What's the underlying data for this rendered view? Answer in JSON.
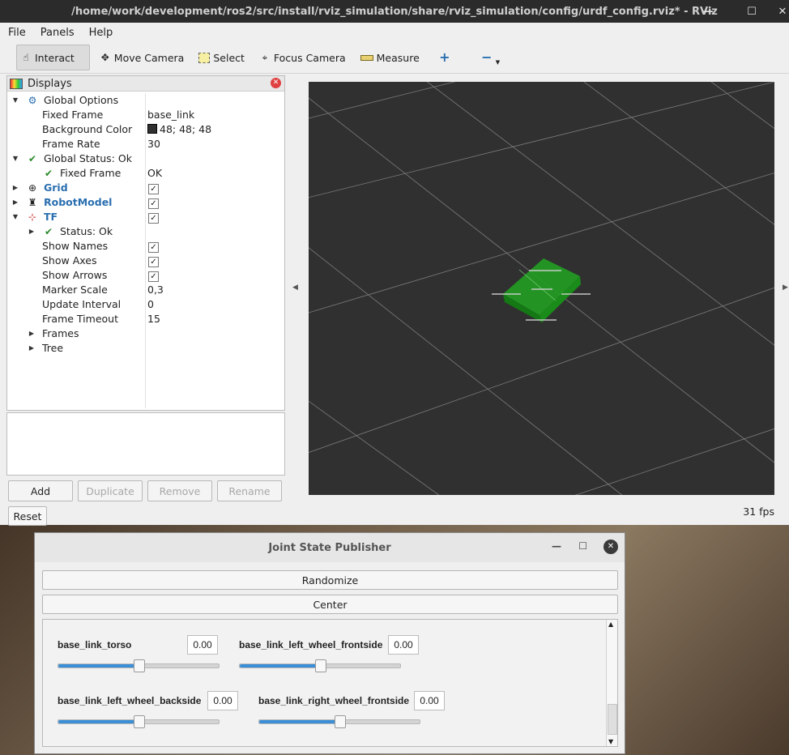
{
  "rviz": {
    "title": "/home/work/development/ros2/src/install/rviz_simulation/share/rviz_simulation/config/urdf_config.rviz* - RViz",
    "menu": [
      "File",
      "Panels",
      "Help"
    ],
    "toolbar": {
      "interact": "Interact",
      "move_camera": "Move Camera",
      "select": "Select",
      "focus_camera": "Focus Camera",
      "measure": "Measure"
    },
    "displays": {
      "title": "Displays",
      "global_options": "Global Options",
      "fixed_frame_label": "Fixed Frame",
      "fixed_frame_value": "base_link",
      "background_color_label": "Background Color",
      "background_color_value": "48; 48; 48",
      "frame_rate_label": "Frame Rate",
      "frame_rate_value": "30",
      "global_status": "Global Status: Ok",
      "status_fixed_frame_label": "Fixed Frame",
      "status_fixed_frame_value": "OK",
      "grid": "Grid",
      "robot_model": "RobotModel",
      "tf": "TF",
      "tf_status": "Status: Ok",
      "show_names": "Show Names",
      "show_axes": "Show Axes",
      "show_arrows": "Show Arrows",
      "marker_scale_label": "Marker Scale",
      "marker_scale_value": "0,3",
      "update_interval_label": "Update Interval",
      "update_interval_value": "0",
      "frame_timeout_label": "Frame Timeout",
      "frame_timeout_value": "15",
      "frames": "Frames",
      "tree": "Tree"
    },
    "buttons": {
      "add": "Add",
      "duplicate": "Duplicate",
      "remove": "Remove",
      "rename": "Rename",
      "reset": "Reset"
    },
    "fps": "31 fps",
    "colors": {
      "viewport_bg": "#303030",
      "robot": "#22a022",
      "accent": "#2a6fb0"
    }
  },
  "jsp": {
    "title": "Joint State Publisher",
    "randomize": "Randomize",
    "center": "Center",
    "joints": [
      {
        "name": "base_link_torso",
        "value": "0.00",
        "level": 0.5
      },
      {
        "name": "base_link_left_wheel_frontside",
        "value": "0.00",
        "level": 0.5
      },
      {
        "name": "base_link_left_wheel_backside",
        "value": "0.00",
        "level": 0.5
      },
      {
        "name": "base_link_right_wheel_frontside",
        "value": "0.00",
        "level": 0.5
      }
    ]
  }
}
